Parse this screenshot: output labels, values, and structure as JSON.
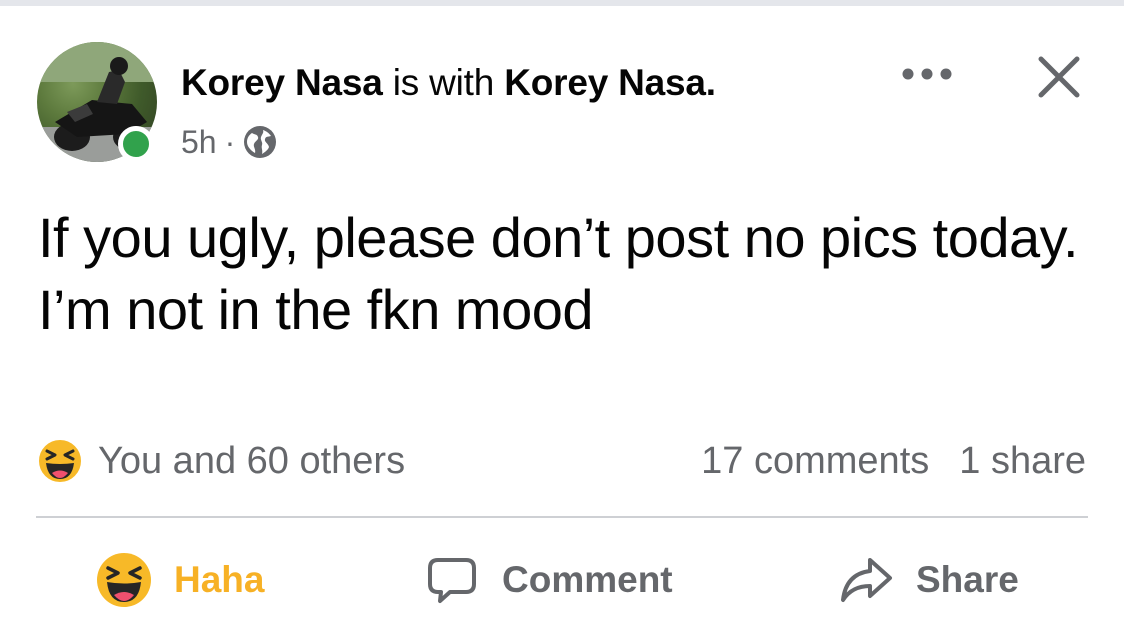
{
  "post": {
    "author": "Korey Nasa",
    "with_text": "is with",
    "tagged": "Korey Nasa.",
    "time": "5h",
    "separator": "·",
    "privacy_icon": "globe-icon",
    "text": "If you ugly, please don’t post no pics today. I’m not in the fkn mood"
  },
  "reactions": {
    "summary": "You and 60 others",
    "emoji_icon": "haha-emoji-icon",
    "comments": "17 comments",
    "shares": "1 share"
  },
  "actions": {
    "haha_label": "Haha",
    "comment_label": "Comment",
    "share_label": "Share"
  },
  "colors": {
    "haha": "#f7b125",
    "secondary": "#65676b",
    "online": "#31a24c",
    "divider": "#ced0d4",
    "text": "#050505"
  }
}
